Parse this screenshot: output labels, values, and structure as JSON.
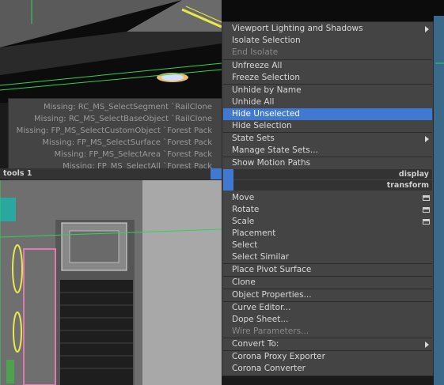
{
  "quad_left": {
    "title": "tools 1",
    "items": [
      "Missing: RC_MS_SelectSegment `RailClone",
      "Missing: RC_MS_SelectBaseObject `RailClone",
      "Missing: FP_MS_SelectCustomObject `Forest Pack",
      "Missing: FP_MS_SelectSurface `Forest Pack",
      "Missing: FP_MS_SelectArea `Forest Pack",
      "Missing: FP_MS_SelectAll `Forest Pack"
    ]
  },
  "display_section": {
    "label": "display",
    "items": [
      {
        "label": "Viewport Lighting and Shadows",
        "submenu": true
      },
      {
        "label": "Isolate Selection"
      },
      {
        "label": "End Isolate",
        "disabled": true
      },
      {
        "label": "Unfreeze All"
      },
      {
        "label": "Freeze Selection"
      },
      {
        "label": "Unhide by Name"
      },
      {
        "label": "Unhide All"
      },
      {
        "label": "Hide Unselected",
        "highlighted": true
      },
      {
        "label": "Hide Selection"
      },
      {
        "label": "State Sets",
        "submenu": true
      },
      {
        "label": "Manage State Sets..."
      },
      {
        "label": "Show Motion Paths"
      }
    ]
  },
  "transform_section": {
    "label": "transform",
    "items": [
      {
        "label": "Move",
        "window_icon": true
      },
      {
        "label": "Rotate",
        "window_icon": true
      },
      {
        "label": "Scale",
        "window_icon": true
      },
      {
        "label": "Placement"
      },
      {
        "label": "Select"
      },
      {
        "label": "Select Similar"
      },
      {
        "label": "Place Pivot Surface"
      },
      {
        "label": "Clone"
      },
      {
        "label": "Object Properties..."
      },
      {
        "label": "Curve Editor..."
      },
      {
        "label": "Dope Sheet..."
      },
      {
        "label": "Wire Parameters...",
        "disabled": true
      },
      {
        "label": "Convert To:",
        "submenu": true
      },
      {
        "label": "Corona Proxy Exporter"
      },
      {
        "label": "Corona Converter"
      }
    ]
  },
  "colors": {
    "menu_bg": "#444444",
    "highlight": "#3f79d1",
    "section_bar": "#333333",
    "text": "#d8d8d8"
  },
  "icons": [
    "submenu-arrow-icon",
    "window-icon"
  ]
}
